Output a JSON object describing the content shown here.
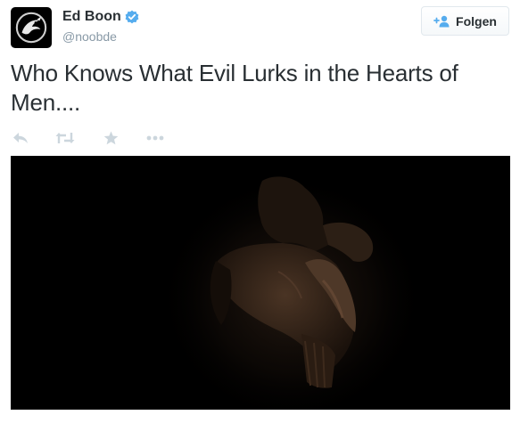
{
  "user": {
    "name": "Ed Boon",
    "handle": "@noobde",
    "verified": true,
    "avatar_icon": "dragon-logo-icon"
  },
  "follow_button": {
    "label": "Folgen",
    "icon": "add-user-icon"
  },
  "tweet": {
    "text": "Who Knows What Evil Lurks in the Hearts of Men...."
  },
  "actions": [
    {
      "name": "reply",
      "icon": "reply-icon"
    },
    {
      "name": "retweet",
      "icon": "retweet-icon"
    },
    {
      "name": "favorite",
      "icon": "star-icon"
    },
    {
      "name": "more",
      "icon": "more-icon"
    }
  ],
  "media": {
    "type": "image",
    "description_icon": "dark-character-image"
  },
  "colors": {
    "text": "#292f33",
    "muted": "#8899a6",
    "verified": "#55acee",
    "icon": "#ccd6dd",
    "border": "#e1e8ed"
  }
}
